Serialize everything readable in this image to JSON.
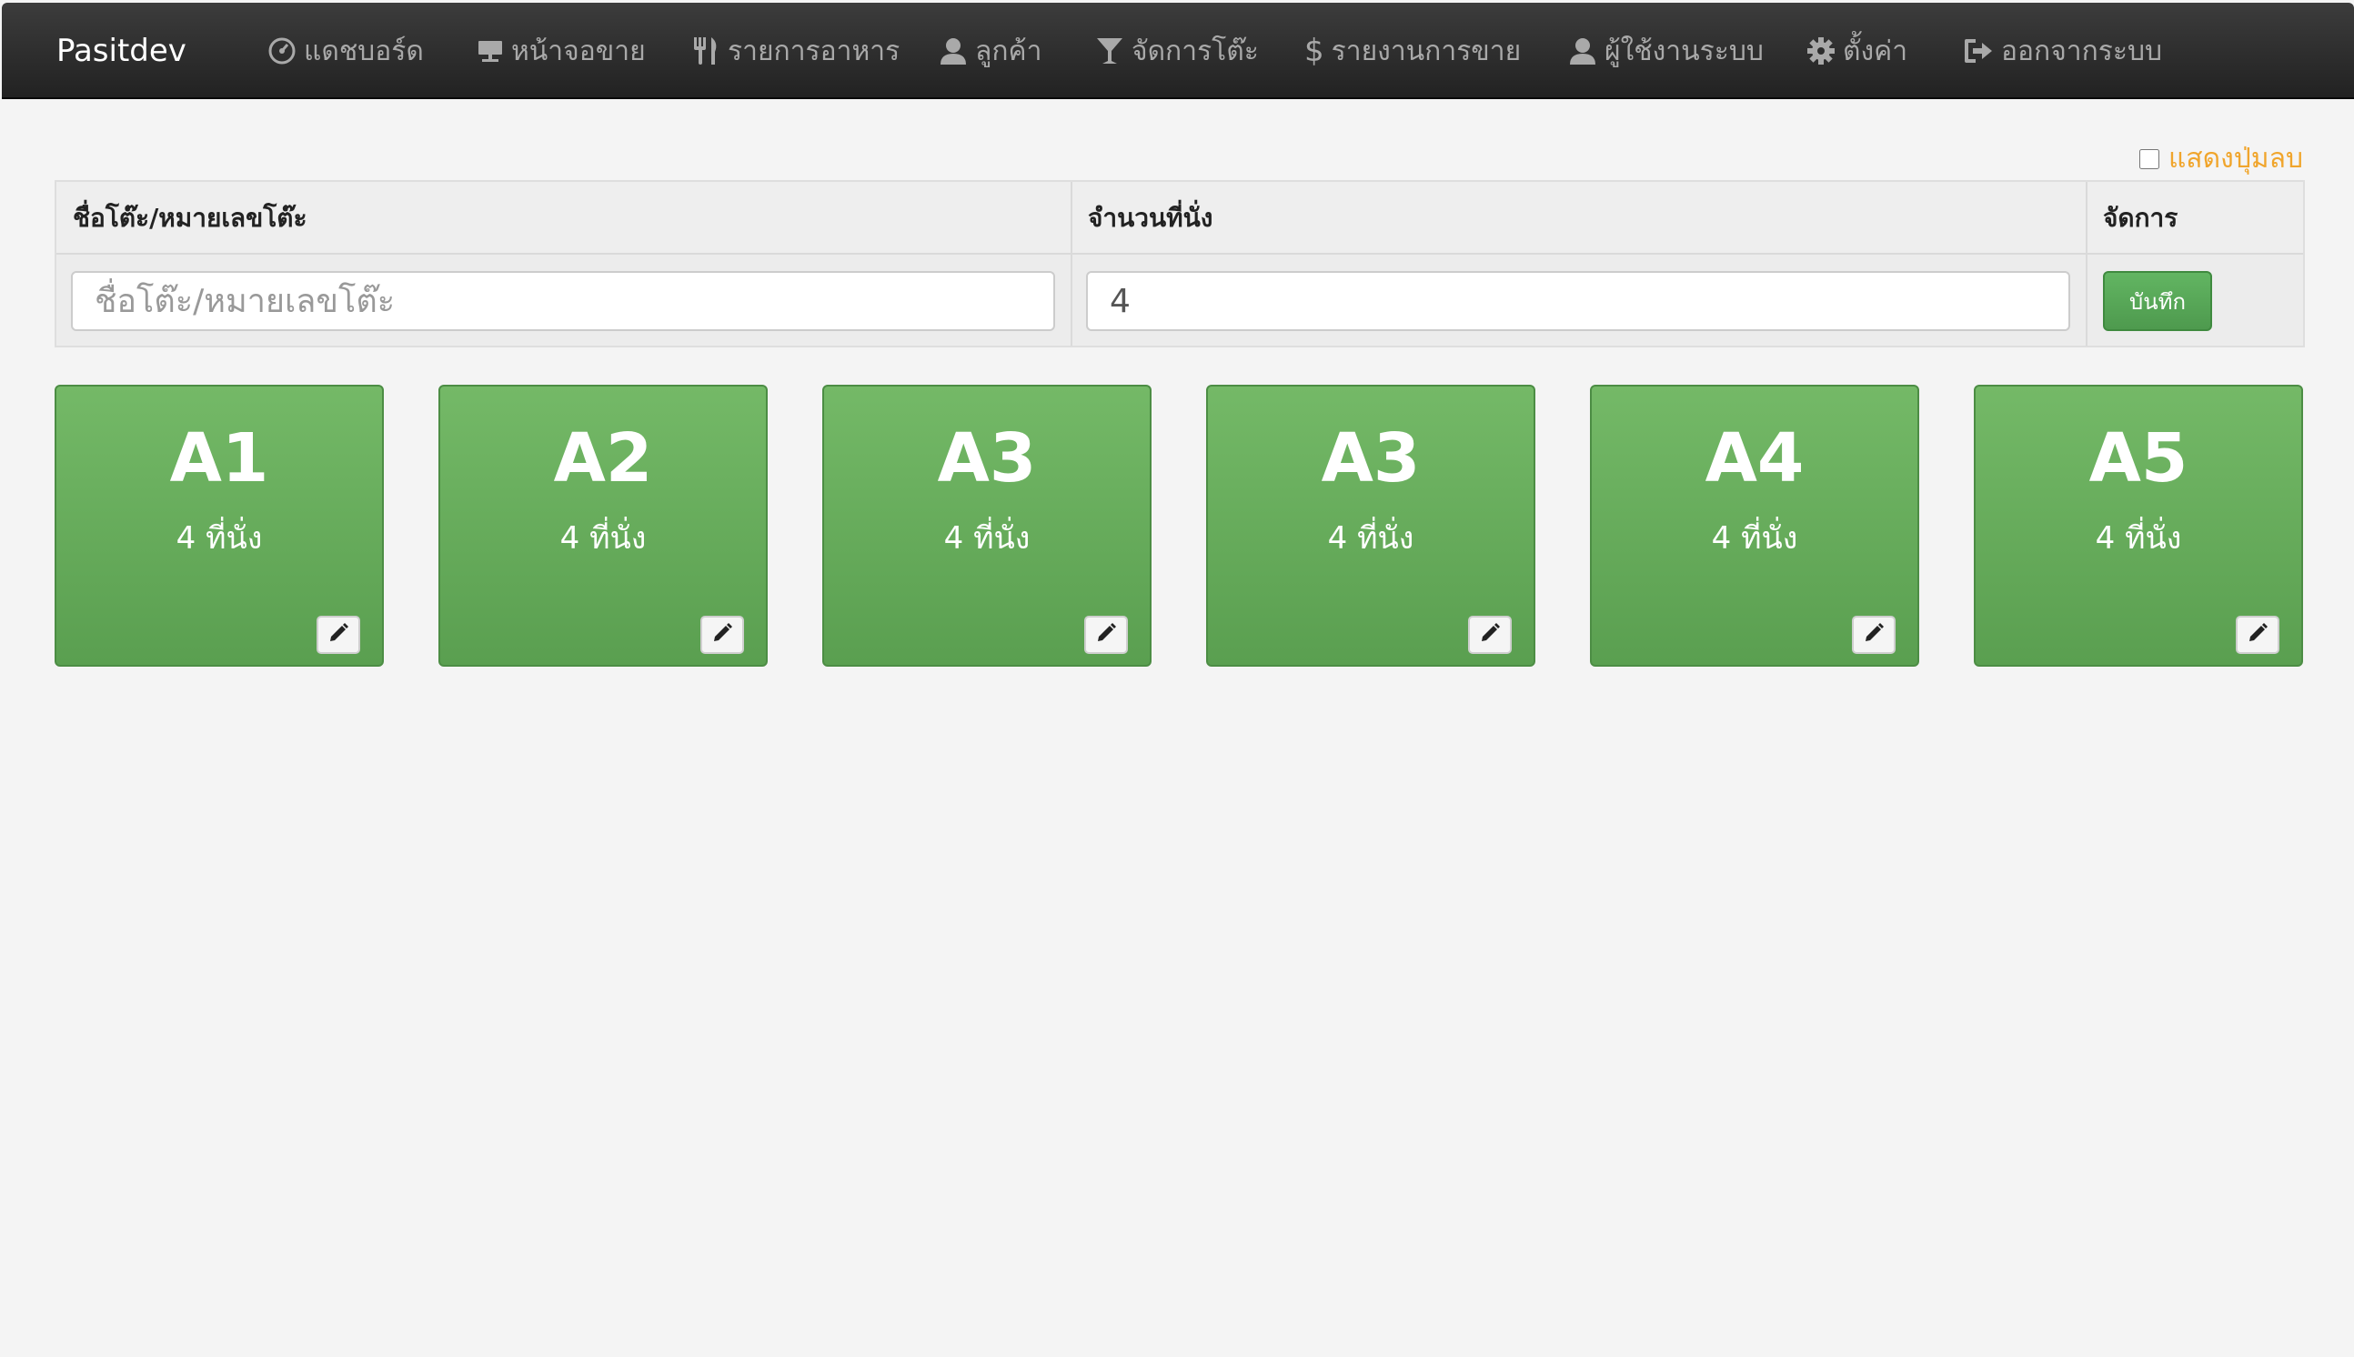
{
  "navbar": {
    "brand": "Pasitdev",
    "items": [
      {
        "label": "แดชบอร์ด",
        "icon": "dashboard-icon"
      },
      {
        "label": "หน้าจอขาย",
        "icon": "screen-icon"
      },
      {
        "label": "รายการอาหาร",
        "icon": "cutlery-icon"
      },
      {
        "label": "ลูกค้า",
        "icon": "user-icon"
      },
      {
        "label": "จัดการโต๊ะ",
        "icon": "glass-icon"
      },
      {
        "label": "รายงานการขาย",
        "icon": "dollar-icon"
      },
      {
        "label": "ผู้ใช้งานระบบ",
        "icon": "user-icon"
      },
      {
        "label": "ตั้งค่า",
        "icon": "gear-icon"
      },
      {
        "label": "ออกจากระบบ",
        "icon": "logout-icon"
      }
    ]
  },
  "delete_toggle": {
    "label": "แสดงปุ่มลบ",
    "checked": false
  },
  "form": {
    "headers": {
      "name": "ชื่อโต๊ะ/หมายเลขโต๊ะ",
      "seats": "จำนวนที่นั่ง",
      "actions": "จัดการ"
    },
    "name_placeholder": "ชื่อโต๊ะ/หมายเลขโต๊ะ",
    "name_value": "",
    "seats_value": "4",
    "save_label": "บันทึก"
  },
  "tables": [
    {
      "name": "A1",
      "seats": "4 ที่นั่ง"
    },
    {
      "name": "A2",
      "seats": "4 ที่นั่ง"
    },
    {
      "name": "A3",
      "seats": "4 ที่นั่ง"
    },
    {
      "name": "A3",
      "seats": "4 ที่นั่ง"
    },
    {
      "name": "A4",
      "seats": "4 ที่นั่ง"
    },
    {
      "name": "A5",
      "seats": "4 ที่นั่ง"
    }
  ],
  "colors": {
    "navbar": "#222222",
    "card": "#68ad5c",
    "accent": "#f0a52c",
    "save_button": "#5cb85c"
  }
}
